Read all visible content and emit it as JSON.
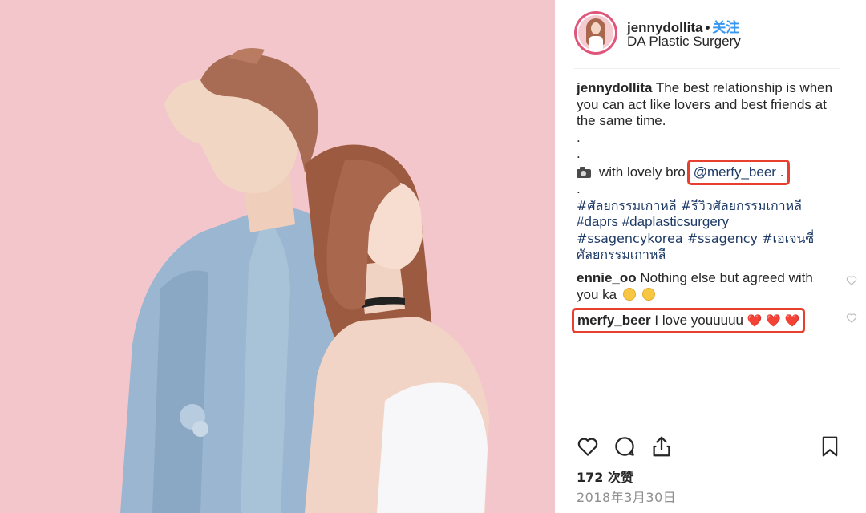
{
  "post": {
    "username": "jennydollita",
    "separator": "•",
    "follow_label": "关注",
    "location": "DA Plastic Surgery"
  },
  "caption": {
    "username": "jennydollita",
    "text": "The best relationship is when you can act like lovers and best friends at the same time.",
    "dot1": ".",
    "dot2": ".",
    "with_text": "with lovely bro",
    "mention": "@merfy_beer",
    "mention_trail": ".",
    "dot3": ".",
    "hashtags_line1": "#ศัลยกรรมเกาหลี #รีวิวศัลยกรรมเกาหลี",
    "hashtags_line2": "#daprs #daplasticsurgery",
    "hashtags_line3": "#ssagencykorea #ssagency #เอเจนซี่",
    "hashtags_line4": "ศัลยกรรมเกาหลี"
  },
  "comments": [
    {
      "username": "ennie_oo",
      "text": "Nothing else but agreed with you ka"
    },
    {
      "username": "merfy_beer",
      "text": "I love youuuuu",
      "hearts": "❤️ ❤️ ❤️"
    }
  ],
  "likes": "172 次赞",
  "date": "2018年3月30日",
  "colors": {
    "photo_background": "#f3c6cb",
    "highlight": "#e8402f",
    "follow": "#3897f0",
    "link": "#1e3a66"
  },
  "icons": [
    "heart-icon",
    "comment-icon",
    "share-icon",
    "bookmark-icon",
    "camera-icon"
  ]
}
